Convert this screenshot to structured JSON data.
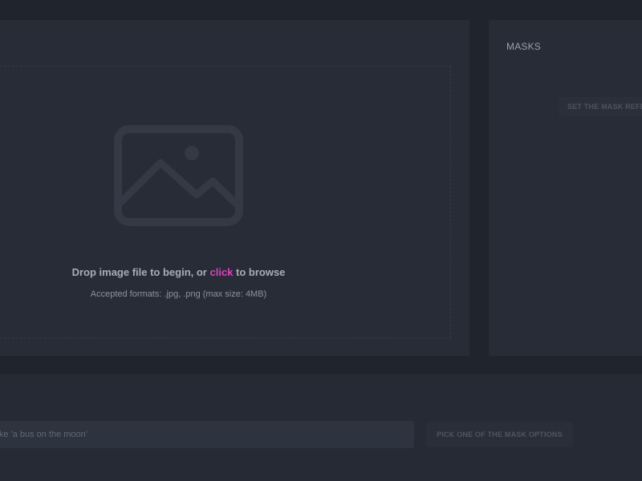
{
  "upload": {
    "drop_text_before": "Drop image file to begin, or ",
    "click_label": "click",
    "drop_text_after": " to browse",
    "accepted_formats": "Accepted formats: .jpg, .png (max size: 4MB)",
    "icon": "image-placeholder-icon"
  },
  "masks": {
    "title": "MASKS",
    "set_reference_label": "SET THE MASK REFERENCE POINT"
  },
  "prompt": {
    "placeholder": "like 'a bus on the moon'",
    "value": ""
  },
  "actions": {
    "pick_mask_label": "PICK ONE OF THE MASK OPTIONS"
  },
  "colors": {
    "background": "#20242d",
    "panel": "#282c37",
    "accent": "#e040c0"
  }
}
